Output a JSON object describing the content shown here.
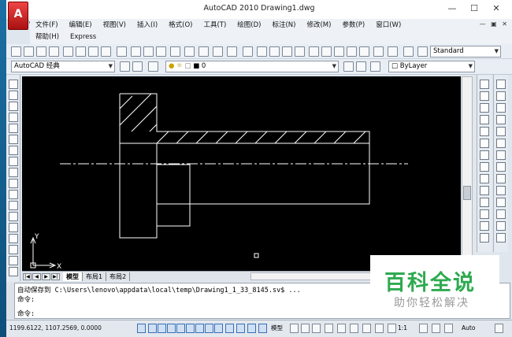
{
  "window": {
    "title": "AutoCAD 2010    Drawing1.dwg",
    "app_button": "A"
  },
  "menu": {
    "row1": [
      "文件(F)",
      "编辑(E)",
      "视图(V)",
      "插入(I)",
      "格式(O)",
      "工具(T)",
      "绘图(D)",
      "标注(N)",
      "修改(M)",
      "参数(P)",
      "窗口(W)"
    ],
    "row2": [
      "帮助(H)",
      "Express"
    ]
  },
  "toolbar": {
    "text_style": "Standard"
  },
  "toolbar2": {
    "workspace": "AutoCAD 经典",
    "layer": "0",
    "color": "ByLayer"
  },
  "canvas": {
    "ucs_x": "X",
    "ucs_y": "Y",
    "line_color": "#ffffff",
    "background": "#000000"
  },
  "tabs": [
    "模型",
    "布局1",
    "布局2"
  ],
  "command": {
    "lines": [
      "自动保存到 C:\\Users\\lenovo\\appdata\\local\\temp\\Drawing1_1_33_8145.sv$ ...",
      "命令:",
      "命令:"
    ]
  },
  "status": {
    "coords": "1199.6122, 1107.2569, 0.0000",
    "model_label": "模型",
    "annotation_scale": "1:1",
    "auto_label": "Auto"
  },
  "watermark": {
    "title": "百科全说",
    "subtitle": "助你轻松解决",
    "color": "#2eaa4f"
  }
}
